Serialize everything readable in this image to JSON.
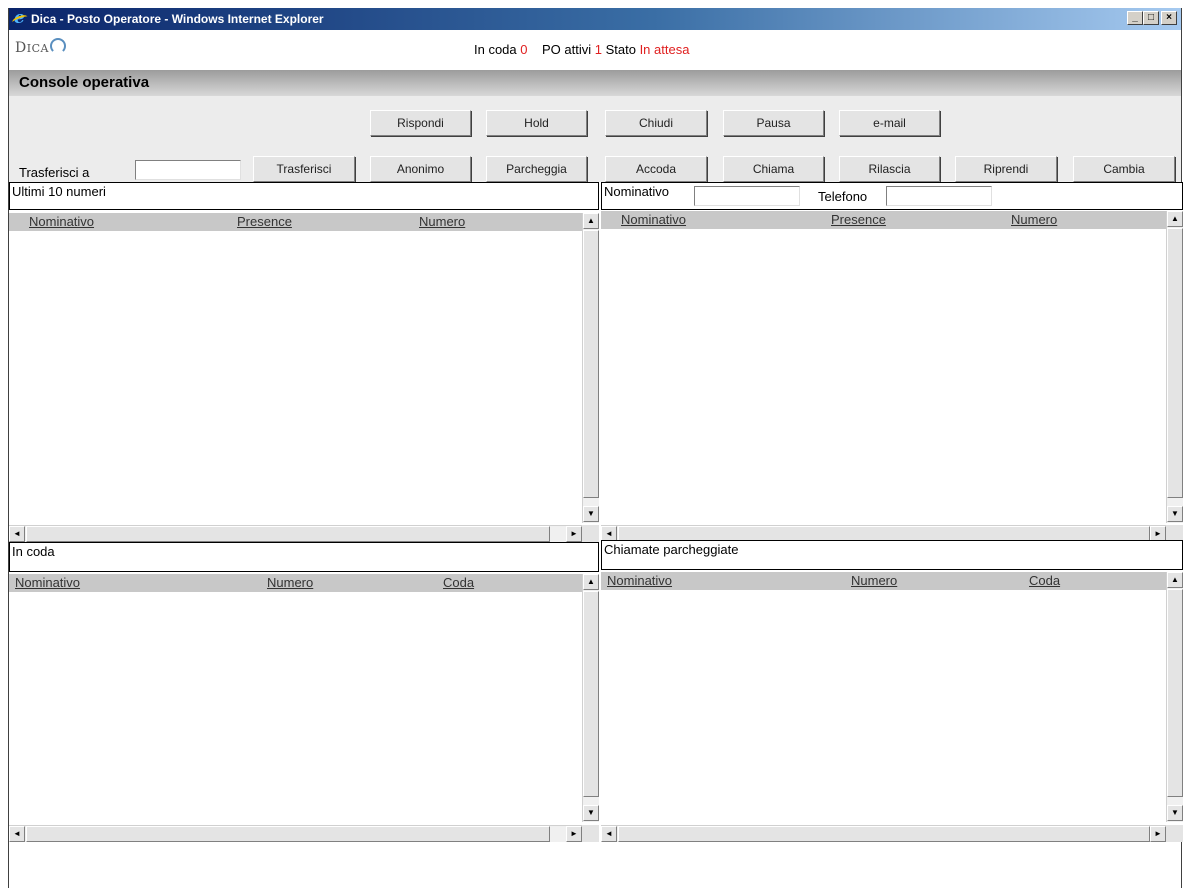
{
  "window": {
    "title": "Dica - Posto Operatore - Windows Internet Explorer",
    "min": "_",
    "max": "□",
    "close": "×"
  },
  "header": {
    "logo_big": "D",
    "logo_small": "ICA",
    "status_queue_label": "In coda",
    "status_queue_value": "0",
    "status_po_label": "PO attivi",
    "status_po_value": "1",
    "status_state_label": "Stato",
    "status_state_value": "In attesa"
  },
  "console": {
    "title": "Console operativa"
  },
  "toolbar": {
    "row1": [
      "Rispondi",
      "Hold",
      "Chiudi",
      "Pausa",
      "e-mail"
    ],
    "transfer_label": "Trasferisci a",
    "transfer_value": "",
    "row2": [
      "Trasferisci",
      "Anonimo",
      "Parcheggia",
      "Accoda",
      "Chiama",
      "Rilascia",
      "Riprendi",
      "Cambia"
    ]
  },
  "panels": {
    "last_numbers": {
      "title": "Ultimi 10 numeri",
      "columns": [
        "Nominativo",
        "Presence",
        "Numero"
      ]
    },
    "directory": {
      "name_label": "Nominativo",
      "name_value": "",
      "phone_label": "Telefono",
      "phone_value": "",
      "columns": [
        "Nominativo",
        "Presence",
        "Numero"
      ]
    },
    "queue": {
      "title": "In coda",
      "columns": [
        "Nominativo",
        "Numero",
        "Coda"
      ]
    },
    "parked": {
      "title": "Chiamate parcheggiate",
      "columns": [
        "Nominativo",
        "Numero",
        "Coda"
      ]
    }
  },
  "scroll": {
    "up": "▲",
    "down": "▼",
    "left": "◄",
    "right": "►"
  }
}
